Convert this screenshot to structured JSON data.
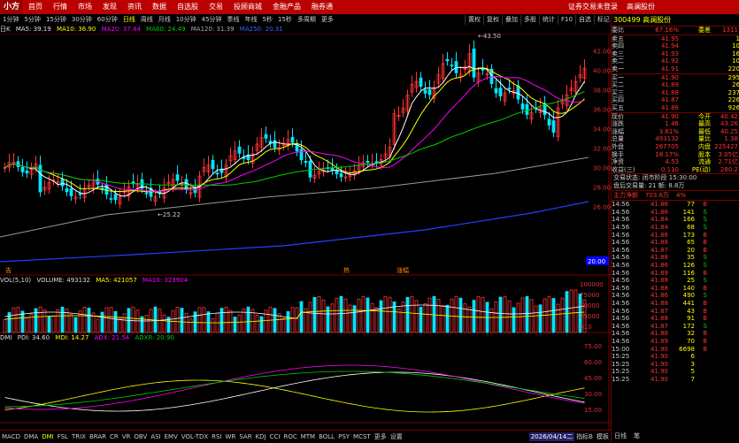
{
  "topbar": {
    "logo": "小方",
    "menu": [
      "首页",
      "行情",
      "市场",
      "发现",
      "资讯",
      "数据",
      "自选股",
      "交易",
      "投顾商城",
      "金融产品",
      "融券通"
    ],
    "right": [
      "证券交易未登录",
      "高澜股份"
    ]
  },
  "periods": {
    "items": [
      "1分钟",
      "5分钟",
      "15分钟",
      "30分钟",
      "60分钟",
      "日线",
      "周线",
      "月线",
      "10分钟",
      "45分钟",
      "季线",
      "年线",
      "5秒",
      "15秒",
      "多周期",
      "更多"
    ],
    "active": "日线",
    "tools": [
      "置权",
      "复权",
      "叠加",
      "多股",
      "统计",
      "F10",
      "自选",
      "标记"
    ]
  },
  "main_ind": {
    "label": "日K",
    "ma5": "MA5: 39.19",
    "ma10": "MA10: 36.90",
    "ma20": "MA20: 37.44",
    "ma60": "MA60: 24.49",
    "ma120": "MA120: 31.39",
    "ma250": "MA250: 20.31",
    "high_note": "43.50",
    "low_note": "25.22"
  },
  "vol_ind": {
    "label": "VOL(5,10)",
    "vol": "VOLUME: 493132",
    "ma5": "MA5: 421057",
    "ma10": "MA10: 323904",
    "axis": [
      "100000",
      "75000",
      "50000",
      "25000",
      "X10"
    ]
  },
  "dmi_ind": {
    "label": "DMI",
    "pdi": "PDI: 34.60",
    "mdi": "MDI: 14.27",
    "adx": "ADX: 21.54",
    "adxr": "ADXR: 20.90",
    "axis": [
      "75.00",
      "60.00",
      "45.00",
      "30.00",
      "15.00"
    ]
  },
  "price_axis": [
    "42.00",
    "40.00",
    "38.00",
    "36.00",
    "34.00",
    "32.00",
    "30.00",
    "28.00",
    "26.00"
  ],
  "price_axis_low": "20.00",
  "markers": {
    "m1": "吉",
    "m2": "热",
    "m3": "涨幅"
  },
  "bottom": {
    "tabs": [
      "MACD",
      "DMA",
      "DMI",
      "FSL",
      "TRIX",
      "BRAR",
      "CR",
      "VR",
      "OBV",
      "ASI",
      "EMV",
      "VOL-TDX",
      "RSI",
      "WR",
      "SAR",
      "KDJ",
      "CCI",
      "ROC",
      "MTM",
      "BOLL",
      "PSY",
      "MCST",
      "更多",
      "设置"
    ],
    "active": "DMI",
    "date": "2026/04/14二",
    "buttons": [
      "指标B",
      "模板"
    ]
  },
  "stock": {
    "code": "300499",
    "name": "高澜股份",
    "webi_label": "委比",
    "webi": "67.16%",
    "weicha_label": "委差",
    "weicha": "1311"
  },
  "sell": [
    {
      "label": "卖五",
      "price": "41.95",
      "vol": "1"
    },
    {
      "label": "卖四",
      "price": "41.94",
      "vol": "10"
    },
    {
      "label": "卖三",
      "price": "41.93",
      "vol": "16"
    },
    {
      "label": "卖二",
      "price": "41.92",
      "vol": "10"
    },
    {
      "label": "卖一",
      "price": "41.91",
      "vol": "220"
    }
  ],
  "buy": [
    {
      "label": "买一",
      "price": "41.90",
      "vol": "295"
    },
    {
      "label": "买二",
      "price": "41.89",
      "vol": "26"
    },
    {
      "label": "买三",
      "price": "41.88",
      "vol": "237"
    },
    {
      "label": "买四",
      "price": "41.87",
      "vol": "226"
    },
    {
      "label": "买五",
      "price": "41.86",
      "vol": "926"
    }
  ],
  "stats": [
    {
      "l": "现价",
      "v": "41.90",
      "l2": "今开",
      "v2": "40.42"
    },
    {
      "l": "涨跌",
      "v": "1.46",
      "l2": "最高",
      "v2": "43.26"
    },
    {
      "l": "涨幅",
      "v": "3.61%",
      "l2": "最低",
      "v2": "40.25"
    },
    {
      "l": "总量",
      "v": "493132",
      "l2": "量比",
      "v2": "1.38"
    },
    {
      "l": "外盘",
      "v": "267705",
      "l2": "内盘",
      "v2": "225427"
    },
    {
      "l": "换手",
      "v": "18.17%",
      "l2": "股本",
      "v2": "3.05亿"
    },
    {
      "l": "净资",
      "v": "4.53",
      "l2": "流通",
      "v2": "2.71亿"
    },
    {
      "l": "收益(三)",
      "v": "0.110",
      "l2": "PE(动)",
      "v2": "280.2"
    }
  ],
  "trade_status": "交易状态: 闭市阶段 15:30:00",
  "order_info": "盘后交易量: 21  额: 8.8万",
  "main_flow": {
    "label": "主力净额",
    "value": "703.6万",
    "pct": "4%"
  },
  "ticks": [
    {
      "t": "14:56",
      "p": "41.86",
      "v": "77",
      "d": "B"
    },
    {
      "t": "14:56",
      "p": "41.86",
      "v": "141",
      "d": "S"
    },
    {
      "t": "14:56",
      "p": "41.84",
      "v": "166",
      "d": "S"
    },
    {
      "t": "14:56",
      "p": "41.84",
      "v": "68",
      "d": "S"
    },
    {
      "t": "14:56",
      "p": "41.86",
      "v": "173",
      "d": "B"
    },
    {
      "t": "14:56",
      "p": "41.88",
      "v": "65",
      "d": "B"
    },
    {
      "t": "14:56",
      "p": "41.87",
      "v": "20",
      "d": "B"
    },
    {
      "t": "14:56",
      "p": "41.88",
      "v": "35",
      "d": "S"
    },
    {
      "t": "14:56",
      "p": "41.86",
      "v": "126",
      "d": "S"
    },
    {
      "t": "14:56",
      "p": "41.89",
      "v": "116",
      "d": "B"
    },
    {
      "t": "14:56",
      "p": "41.88",
      "v": "25",
      "d": "S"
    },
    {
      "t": "14:56",
      "p": "41.88",
      "v": "140",
      "d": "B"
    },
    {
      "t": "14:56",
      "p": "41.86",
      "v": "490",
      "d": "S"
    },
    {
      "t": "14:56",
      "p": "41.88",
      "v": "441",
      "d": "B"
    },
    {
      "t": "14:56",
      "p": "41.87",
      "v": "43",
      "d": "B"
    },
    {
      "t": "14:56",
      "p": "41.88",
      "v": "91",
      "d": "B"
    },
    {
      "t": "14:56",
      "p": "41.87",
      "v": "172",
      "d": "S"
    },
    {
      "t": "14:56",
      "p": "41.88",
      "v": "32",
      "d": "B"
    },
    {
      "t": "14:56",
      "p": "41.89",
      "v": "70",
      "d": "B"
    },
    {
      "t": "15:00",
      "p": "41.90",
      "v": "6698",
      "d": "B"
    },
    {
      "t": "15:25",
      "p": "41.90",
      "v": "6",
      "d": ""
    },
    {
      "t": "15:25",
      "p": "41.90",
      "v": "3",
      "d": ""
    },
    {
      "t": "15:25",
      "p": "41.90",
      "v": "5",
      "d": ""
    },
    {
      "t": "15:25",
      "p": "41.90",
      "v": "7",
      "d": ""
    }
  ],
  "right_bottom": [
    "日线",
    "笔"
  ],
  "colors": {
    "up": "#ff3333",
    "down": "#00e5ff",
    "ma5": "#ffffff",
    "ma10": "#ffff00",
    "ma20": "#ff00ff",
    "ma60": "#00cc00",
    "ma120": "#999999",
    "ma250": "#2040ff"
  }
}
